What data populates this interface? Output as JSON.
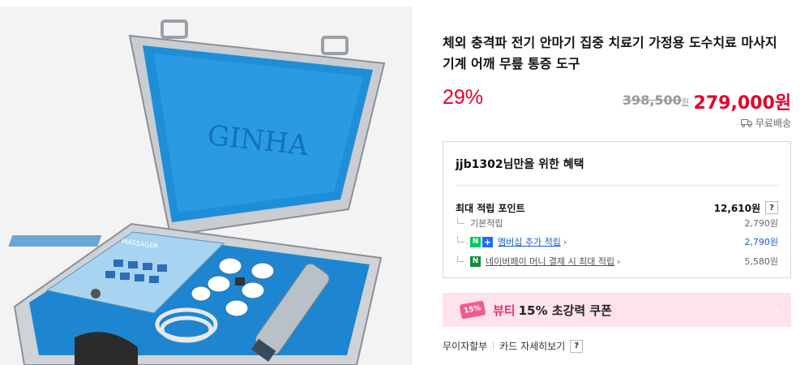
{
  "product": {
    "title": "체외 충격파 전기 안마기 집중 치료기 가정용 도수치료 마사지 기계 어깨 무릎 통증 도구",
    "image_label": "GINHA",
    "device_label": "MASSAGER"
  },
  "price": {
    "discount": "29%",
    "original": "398,500",
    "original_unit": "원",
    "sale": "279,000원"
  },
  "shipping": {
    "label": "무료배송",
    "icon": "truck-icon"
  },
  "benefits": {
    "title": "jjb1302님만을 위한 혜택",
    "max_points_label": "최대 적립 포인트",
    "max_points_value": "12,610원",
    "help": "?",
    "rows": [
      {
        "label": "기본적립",
        "value": "2,790원"
      },
      {
        "badge_n": "N",
        "badge_plus": "+",
        "label": "멤버십 추가 적립",
        "value": "2,790원"
      },
      {
        "badge_n": "N",
        "label": "네이버페이 머니 결제 시 최대 적립",
        "value": "5,580원"
      }
    ]
  },
  "coupon": {
    "badge": "15%",
    "brand": "뷰티",
    "text": "15% 초강력 쿠폰",
    "arrow": "›"
  },
  "footer": {
    "installment": "무이자할부",
    "card_detail": "카드 자세히보기",
    "help": "?"
  },
  "colors": {
    "accent_red": "#e5002b",
    "link_blue": "#1d5ad6",
    "coupon_bg": "#ffe3ec",
    "npay_green": "#03c75a"
  }
}
